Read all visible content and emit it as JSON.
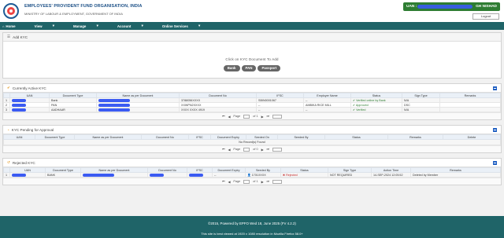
{
  "header": {
    "org_title": "EMPLOYEES' PROVIDENT FUND ORGANISATION, INDIA",
    "ministry": "MINISTRY OF LABOUR & EMPLOYMENT, GOVERNMENT OF INDIA",
    "uan_label": "UAN :",
    "uan_name": "GH NISHAD",
    "logout": "Logout"
  },
  "nav": {
    "home": "Home",
    "view": "View",
    "manage": "Manage",
    "account": "Account",
    "online_services": "Online Services"
  },
  "add_kyc": {
    "title": "Add KYC",
    "instruction": "Click on KYC Document To Add",
    "buttons": [
      "Bank",
      "PAN",
      "Passport"
    ]
  },
  "active_kyc": {
    "title": "Currently Active KYC",
    "columns": [
      "",
      "UAN",
      "Document Type",
      "Name as per Document",
      "Document No",
      "IFSC",
      "Employer Name",
      "Status",
      "Sign Type",
      "Remarks"
    ],
    "rows": [
      [
        "1",
        "",
        "Bank",
        "",
        "3788056XXXX",
        "SBIN0001067",
        "--",
        "Verified online by Bank",
        "N/A",
        ""
      ],
      [
        "2",
        "",
        "PAN",
        "",
        "XXWPN2XXXX",
        "--",
        "AMBIKA RICE MILL",
        "Approved",
        "DSC",
        ""
      ],
      [
        "3",
        "",
        "AADHAAR",
        "",
        "XXXX XXXX 4919",
        "--",
        "--",
        "Verified",
        "N/A",
        ""
      ]
    ],
    "pager": {
      "page_label": "Page",
      "page": "1",
      "of": "of 1"
    }
  },
  "pending_kyc": {
    "title": "KYC Pending for Approval",
    "columns": [
      "UAN",
      "Document Type",
      "Name as per Document",
      "Document No",
      "IFSC",
      "Document Expiry",
      "Seeded On",
      "Seeded By",
      "Status",
      "Remarks",
      "Delete"
    ],
    "empty": "No Record(s) Found",
    "pager": {
      "page_label": "Page",
      "page": "1",
      "of": "of 0"
    }
  },
  "rejected_kyc": {
    "title": "Rejected KYC",
    "columns": [
      "",
      "UAN",
      "Document Type",
      "Name as per Document",
      "Document No",
      "IFSC",
      "Document Expiry",
      "Seeded By",
      "Status",
      "Sign Type",
      "Action Time",
      "Remarks"
    ],
    "rows": [
      [
        "1",
        "",
        "BANK",
        "",
        "",
        "",
        "--",
        "1701XXXX",
        "Rejected",
        "NOT REQUIRED",
        "14-SEP-2024 12:05:52",
        "Deleted by Member"
      ]
    ],
    "pager": {
      "page_label": "Page",
      "page": "1",
      "of": "of 1"
    }
  },
  "footer": {
    "line1": "©2015, Powered by EPFO Wed 18, June 2025 (FV 4.2.2)",
    "line2": "This site is best viewed at 1920 x 1080 resolution in Mozilla Firefox 58.0+"
  }
}
